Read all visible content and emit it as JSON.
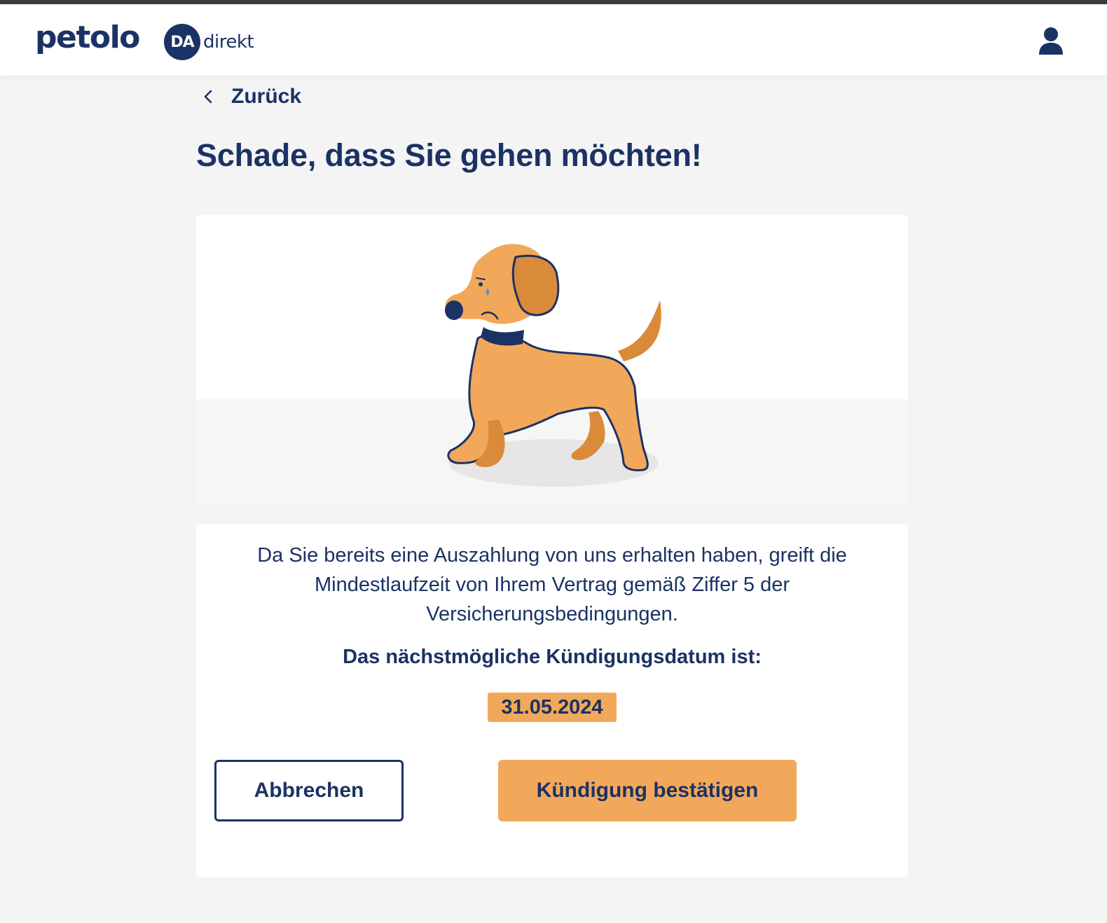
{
  "header": {
    "brand": "petolo",
    "partner_badge": "DA",
    "partner_word": "direkt",
    "user_icon": "user-icon"
  },
  "nav": {
    "back_label": "Zurück",
    "back_icon": "chevron-left-icon"
  },
  "page": {
    "title": "Schade, dass Sie gehen möchten!"
  },
  "illustration": {
    "subject": "sad-dog-illustration"
  },
  "cancellation": {
    "info_text": "Da Sie bereits eine Auszahlung von uns erhalten haben, greift die Mindestlaufzeit von Ihrem Vertrag gemäß Ziffer 5 der Versicherungsbedingungen.",
    "date_label": "Das nächstmögliche Kündigungsdatum ist:",
    "date_value": "31.05.2024"
  },
  "actions": {
    "cancel_label": "Abbrechen",
    "confirm_label": "Kündigung bestätigen"
  },
  "colors": {
    "navy": "#1b3264",
    "accent_orange": "#f2a85a",
    "page_background": "#f4f4f4",
    "card_background": "#ffffff"
  }
}
